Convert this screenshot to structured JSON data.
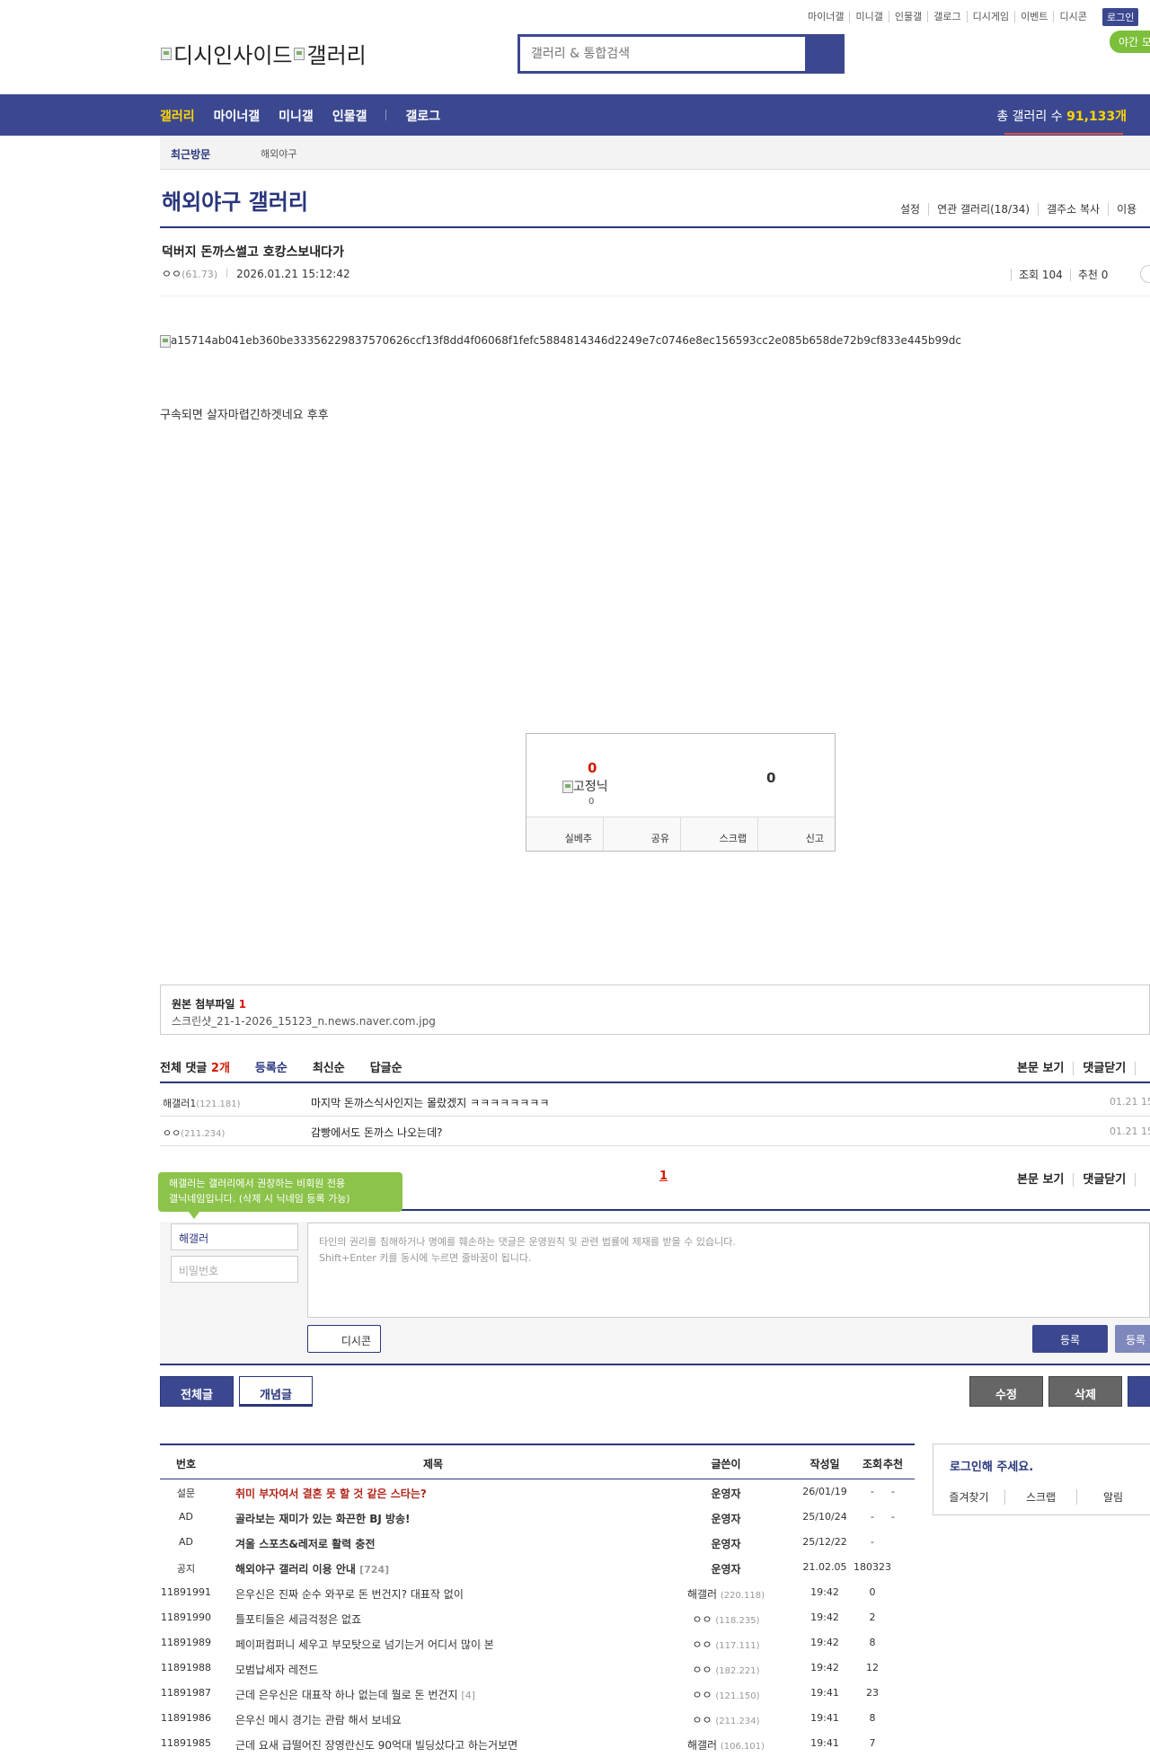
{
  "top_nav": [
    "마이너갤",
    "미니갤",
    "인물갤",
    "갤로그",
    "디시게임",
    "이벤트",
    "디시콘"
  ],
  "login_label": "로그인",
  "night_mode_label": "야간 모",
  "logo_alt_1": "디시인사이드",
  "logo_alt_2": "갤러리",
  "search_placeholder": "갤러리 & 통합검색",
  "gnb": {
    "items": [
      "갤러리",
      "마이너갤",
      "미니갤",
      "인물갤",
      "갤로그"
    ],
    "total_label": "총 갤러리 수",
    "total_value": "91,133개"
  },
  "recent": {
    "label": "최근방문",
    "item": "해외야구"
  },
  "gallery_title": "해외야구 갤러리",
  "gallery_tools": [
    "설정",
    "연관 갤러리(18/34)",
    "갤주소 복사",
    "이용"
  ],
  "post": {
    "title": "덕버지 돈까스썰고 호캉스보내다가",
    "author": "ㅇㅇ",
    "author_ip": "(61.73)",
    "datetime": "2026.01.21 15:12:42",
    "views": "조회 104",
    "recommends": "추천 0",
    "image_alt": "a15714ab041eb360be3335622983757062​6ccf13f8dd4f06068f1fefc5884814346d2249e7c0746e8ec156593cc2e085b658de72b9cf833e445b99dc",
    "body": "구속되면 살자마렵긴하겟네요 후후"
  },
  "recommend_box": {
    "up_count": "0",
    "fixed_nick_alt": "고정닉",
    "fixed_count": "0",
    "down_count": "0",
    "buttons": [
      "실베추",
      "공유",
      "스크랩",
      "신고"
    ]
  },
  "attachment": {
    "label": "원본 첨부파일",
    "count": "1",
    "file": "스크린샷_21-1-2026_15123_n.news.naver.com.jpg"
  },
  "comments": {
    "total_label": "전체 댓글",
    "total_count": "2개",
    "sort": [
      "등록순",
      "최신순",
      "답글순"
    ],
    "actions": [
      "본문 보기",
      "댓글닫기"
    ],
    "items": [
      {
        "nick": "해갤러1",
        "ip": "(121.181)",
        "text": "마지막 돈까스식사인지는 몰랐겠지 ㅋㅋㅋㅋㅋㅋㅋㅋ",
        "date": "01.21 15"
      },
      {
        "nick": "ㅇㅇ",
        "ip": "(211.234)",
        "text": "감빵에서도 돈까스 나오는데?",
        "date": "01.21 15"
      }
    ],
    "page": "1"
  },
  "write": {
    "tooltip_line1": "해갤러는 갤러리에서 권장하는 비회원 전용",
    "tooltip_line2": "갤닉네임입니다. (삭제 시 닉네임 등록 가능)",
    "name_value": "해갤러",
    "password_placeholder": "비밀번호",
    "textarea_line1": "타인의 권리를 침해하거나 명예를 훼손하는 댓글은 운영원칙 및 관련 법률에 제재를 받을 수 있습니다.",
    "textarea_line2": "Shift+Enter 키를 동시에 누르면 줄바꿈이 됩니다.",
    "dccon_label": "디시콘",
    "submit_label": "등록",
    "submit2_label": "등록"
  },
  "bottom_buttons": {
    "all": "전체글",
    "recommended": "개념글",
    "edit": "수정",
    "delete": "삭제"
  },
  "list": {
    "headers": {
      "no": "번호",
      "title": "제목",
      "writer": "글쓴이",
      "date": "작성일",
      "views": "조회",
      "rec": "추천"
    },
    "rows": [
      {
        "no": "설문",
        "title": "취미 부자여서 결혼 못 할 것 같은 스타는?",
        "red": true,
        "writer": "운영자",
        "writer_bold": true,
        "ip": "",
        "comments": "",
        "date": "26/01/19",
        "views": "-",
        "rec": "-",
        "bold": true
      },
      {
        "no": "AD",
        "title": "골라보는 재미가 있는 화끈한 BJ 방송!",
        "red": false,
        "writer": "운영자",
        "writer_bold": true,
        "ip": "",
        "comments": "",
        "date": "25/10/24",
        "views": "-",
        "rec": "-",
        "bold": true
      },
      {
        "no": "AD",
        "title": "겨울 스포츠&레저로 활력 충전",
        "red": false,
        "writer": "운영자",
        "writer_bold": true,
        "ip": "",
        "comments": "",
        "date": "25/12/22",
        "views": "-",
        "rec": "",
        "bold": true
      },
      {
        "no": "공지",
        "title": "해외야구 갤러리 이용 안내",
        "red": false,
        "writer": "운영자",
        "writer_bold": true,
        "ip": "",
        "comments": "[724]",
        "date": "21.02.05",
        "views": "180323",
        "rec": "",
        "bold": true
      },
      {
        "no": "11891991",
        "title": "은우신은 진짜 순수 와꾸로 돈 번건지? 대표작 없이",
        "red": false,
        "writer": "해갤러",
        "writer_bold": false,
        "ip": "(220.118)",
        "comments": "",
        "date": "19:42",
        "views": "0",
        "rec": "",
        "bold": false
      },
      {
        "no": "11891990",
        "title": "틀포티들은 세금걱정은 없죠",
        "red": false,
        "writer": "ㅇㅇ",
        "writer_bold": false,
        "ip": "(118.235)",
        "comments": "",
        "date": "19:42",
        "views": "2",
        "rec": "",
        "bold": false
      },
      {
        "no": "11891989",
        "title": "페이퍼컴퍼니 세우고 부모탓으로 넘기는거 어디서 많이 본",
        "red": false,
        "writer": "ㅇㅇ",
        "writer_bold": false,
        "ip": "(117.111)",
        "comments": "",
        "date": "19:42",
        "views": "8",
        "rec": "",
        "bold": false
      },
      {
        "no": "11891988",
        "title": "모범납세자 레전드",
        "red": false,
        "writer": "ㅇㅇ",
        "writer_bold": false,
        "ip": "(182.221)",
        "comments": "",
        "date": "19:42",
        "views": "12",
        "rec": "",
        "bold": false
      },
      {
        "no": "11891987",
        "title": "근데 은우신은 대표작 하나 없는데 뭘로 돈 번건지",
        "red": false,
        "writer": "ㅇㅇ",
        "writer_bold": false,
        "ip": "(121.150)",
        "comments": "[4]",
        "date": "19:41",
        "views": "23",
        "rec": "",
        "bold": false
      },
      {
        "no": "11891986",
        "title": "은우신 메시 경기는 관람 해서 보네요",
        "red": false,
        "writer": "ㅇㅇ",
        "writer_bold": false,
        "ip": "(211.234)",
        "comments": "",
        "date": "19:41",
        "views": "8",
        "rec": "",
        "bold": false
      },
      {
        "no": "11891985",
        "title": "근데 요새 급떨어진 장영란신도 90억대 빌딩샀다고 하는거보면",
        "red": false,
        "writer": "해갤러",
        "writer_bold": false,
        "ip": "(106.101)",
        "comments": "",
        "date": "19:41",
        "views": "7",
        "rec": "",
        "bold": false
      }
    ]
  },
  "login_box": {
    "title": "로그인해 주세요.",
    "menu": [
      "즐겨찾기",
      "스크랩",
      "알림"
    ]
  }
}
